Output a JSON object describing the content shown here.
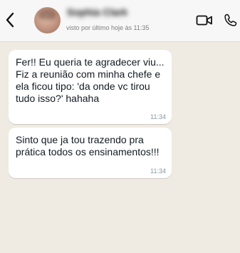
{
  "header": {
    "back_icon": "chevron-left-icon",
    "contact_name": "Sophia Clark",
    "status": "visto por último hoje às 11:35",
    "video_icon": "video-camera-icon",
    "phone_icon": "phone-icon"
  },
  "messages": [
    {
      "text": "Fer!! Eu queria te agradecer viu... Fiz a reunião com minha chefe e ela ficou tipo: 'da onde vc tirou tudo isso?' hahaha",
      "time": "11:34"
    },
    {
      "text": "Sinto que ja tou trazendo pra prática todos os ensinamentos!!!",
      "time": "11:34"
    }
  ],
  "colors": {
    "header_background": "#f7f7f7",
    "chat_background": "#efeae2",
    "bubble_background": "#ffffff",
    "text": "#111b21",
    "timestamp": "#8696a0"
  }
}
